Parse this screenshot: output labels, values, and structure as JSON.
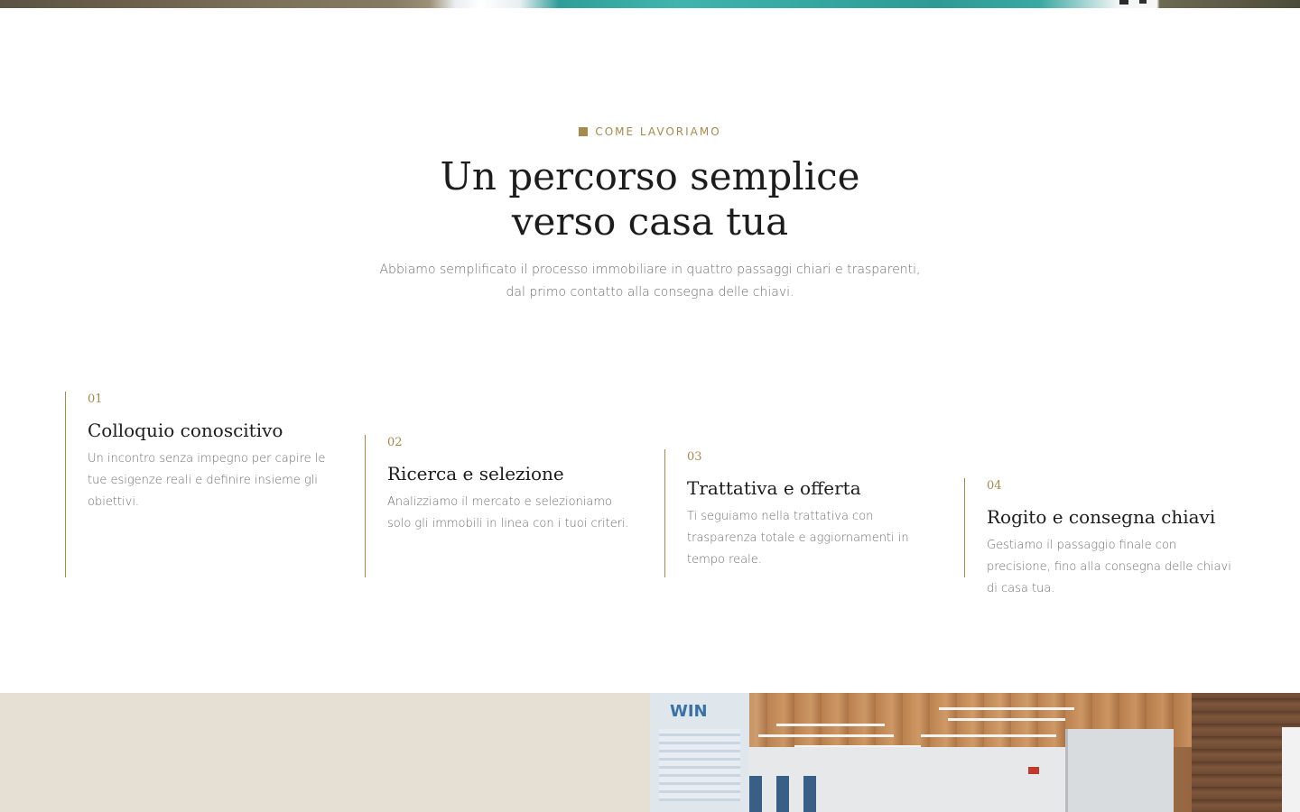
{
  "section": {
    "eyebrow": "COME LAVORIAMO",
    "title_line1": "Un percorso semplice",
    "title_line2": "verso casa tua",
    "subtitle": "Abbiamo semplificato il processo immobiliare in quattro passaggi chiari e trasparenti, dal primo contatto alla consegna delle chiavi."
  },
  "steps": [
    {
      "number": "01",
      "title": "Colloquio conoscitivo",
      "description": "Un incontro senza impegno per capire le tue esigenze reali e definire insieme gli obiettivi."
    },
    {
      "number": "02",
      "title": "Ricerca e selezione",
      "description": "Analizziamo il mercato e selezioniamo solo gli immobili in linea con i tuoi criteri."
    },
    {
      "number": "03",
      "title": "Trattativa e offerta",
      "description": "Ti seguiamo nella trattativa con trasparenza totale e aggiornamenti in tempo reale."
    },
    {
      "number": "04",
      "title": "Rogito e consegna chiavi",
      "description": "Gestiamo il passaggio finale con precisione, fino alla consegna delle chiavi di casa tua."
    }
  ],
  "office_photo": {
    "wall_text": "WIN"
  },
  "colors": {
    "accent": "#a68a4c",
    "heading": "#1c1c1c",
    "body_text": "#6e6e6e",
    "beige_band": "#e6dfd3"
  }
}
